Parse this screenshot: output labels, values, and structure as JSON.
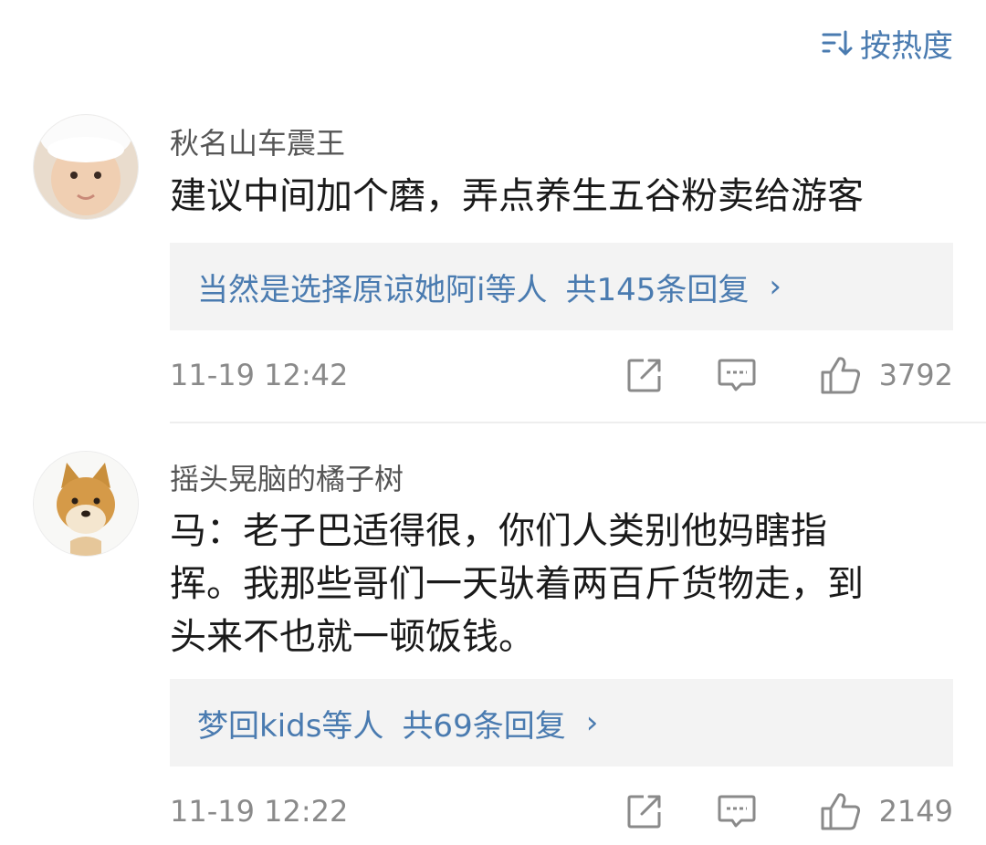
{
  "sort": {
    "label": "按热度",
    "icon": "sort-icon"
  },
  "comments": [
    {
      "username": "秋名山车震王",
      "text": "建议中间加个磨，弄点养生五谷粉卖给游客",
      "replies_by": "当然是选择原谅她阿i等人",
      "replies_total": "共145条回复",
      "chevron": "›",
      "time": "11-19 12:42",
      "likes": "3792",
      "avatar": "baby-avatar"
    },
    {
      "username": "摇头晃脑的橘子树",
      "text_lines": [
        "马：老子巴适得很，你们人类别他妈瞎指",
        "挥。我那些哥们一天驮着两百斤货物走，到",
        "头来不也就一顿饭钱。"
      ],
      "replies_by": "梦回kids等人",
      "replies_total": "共69条回复",
      "chevron": "›",
      "time": "11-19 12:22",
      "likes": "2149",
      "avatar": "shiba-dog-avatar"
    }
  ],
  "icons": [
    "share-icon",
    "comment-icon",
    "like-icon"
  ],
  "colors": {
    "link": "#4a7bb0",
    "meta": "#8a8a8a",
    "reply_bg": "#f3f3f3"
  }
}
